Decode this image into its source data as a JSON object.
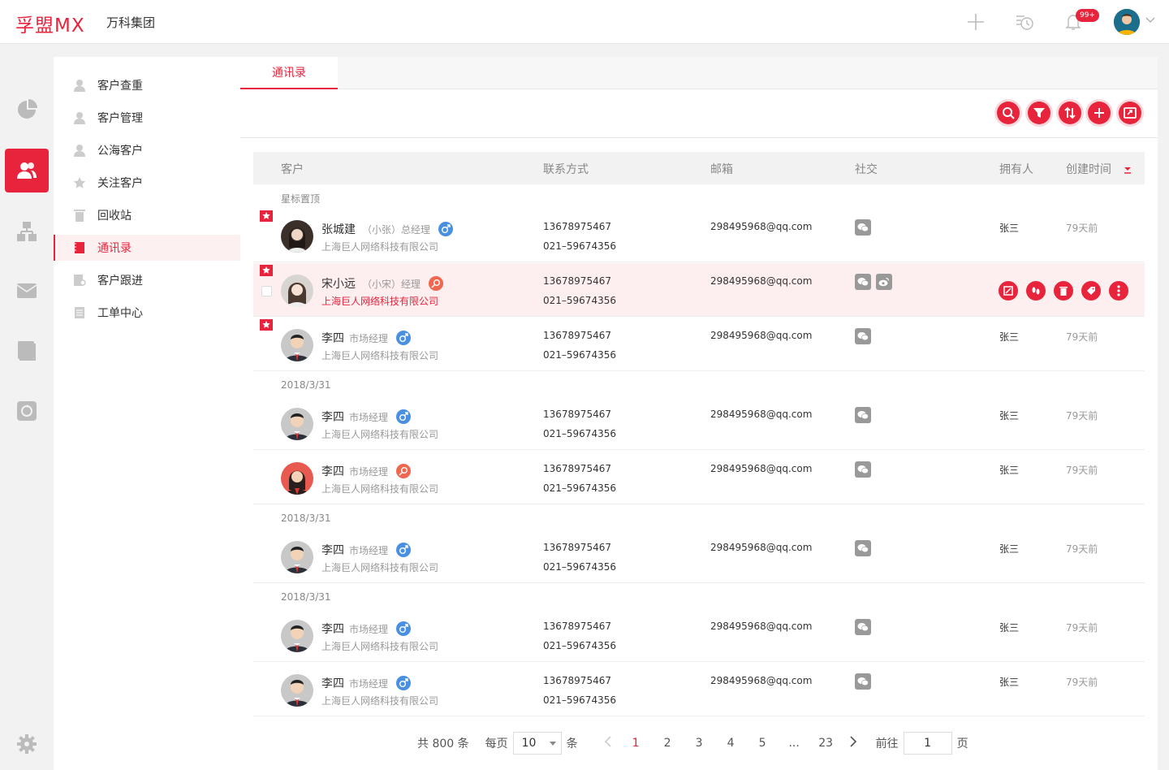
{
  "topbar": {
    "logo": "孚盟MX",
    "company": "万科集团",
    "notification_badge": "99+",
    "icons": [
      "plus-icon",
      "history-icon",
      "bell-icon",
      "avatar",
      "chevron-down-icon"
    ]
  },
  "rail": {
    "items": [
      "pie-chart-icon",
      "users-icon",
      "org-chart-icon",
      "mail-icon",
      "book-icon",
      "recycle-icon",
      "settings-icon"
    ],
    "active": "users-icon"
  },
  "subnav": {
    "items": [
      {
        "label": "客户查重",
        "icon": "user-search-icon"
      },
      {
        "label": "客户管理",
        "icon": "user-icon"
      },
      {
        "label": "公海客户",
        "icon": "user-public-icon"
      },
      {
        "label": "关注客户",
        "icon": "star-icon"
      },
      {
        "label": "回收站",
        "icon": "trash-icon"
      },
      {
        "label": "通讯录",
        "icon": "contacts-icon"
      },
      {
        "label": "客户跟进",
        "icon": "followup-icon"
      },
      {
        "label": "工单中心",
        "icon": "ticket-icon"
      }
    ],
    "active_index": 5
  },
  "main": {
    "tab": "通讯录",
    "toolbar": [
      "search-icon",
      "filter-icon",
      "sort-icon",
      "add-icon",
      "export-icon"
    ]
  },
  "table": {
    "headers": {
      "customer": "客户",
      "contact": "联系方式",
      "email": "邮箱",
      "social": "社交",
      "owner": "拥有人",
      "created": "创建时间"
    },
    "groups": [
      {
        "label": "星标置顶",
        "rows": [
          {
            "name": "张城建",
            "nickname": "（小张）",
            "title": "总经理",
            "gender": "male",
            "company": "上海巨人网络科技有限公司",
            "phone": "13678975467",
            "tel": "021–59674356",
            "email": "298495968@qq.com",
            "social": [
              "wechat"
            ],
            "owner": "张三",
            "created": "79天前",
            "starred": true,
            "avatar": "woman-dark"
          },
          {
            "name": "宋小远",
            "nickname": "（小宋）",
            "title": "经理",
            "gender": "female",
            "company": "上海巨人网络科技有限公司",
            "phone": "13678975467",
            "tel": "021–59674356",
            "email": "298495968@qq.com",
            "social": [
              "wechat",
              "weibo"
            ],
            "owner": "",
            "created": "",
            "starred": true,
            "highlight": true,
            "avatar": "woman-light",
            "actions": [
              "edit-icon",
              "footprint-icon",
              "delete-icon",
              "tag-icon",
              "more-icon"
            ]
          },
          {
            "name": "李四",
            "nickname": "",
            "title": "市场经理",
            "gender": "male",
            "company": "上海巨人网络科技有限公司",
            "phone": "13678975467",
            "tel": "021–59674356",
            "email": "298495968@qq.com",
            "social": [
              "wechat"
            ],
            "owner": "张三",
            "created": "79天前",
            "starred": true,
            "avatar": "man"
          }
        ]
      },
      {
        "label": "2018/3/31",
        "rows": [
          {
            "name": "李四",
            "nickname": "",
            "title": "市场经理",
            "gender": "male",
            "company": "上海巨人网络科技有限公司",
            "phone": "13678975467",
            "tel": "021–59674356",
            "email": "298495968@qq.com",
            "social": [
              "wechat"
            ],
            "owner": "张三",
            "created": "79天前",
            "avatar": "man"
          },
          {
            "name": "李四",
            "nickname": "",
            "title": "市场经理",
            "gender": "female",
            "company": "上海巨人网络科技有限公司",
            "phone": "13678975467",
            "tel": "021–59674356",
            "email": "298495968@qq.com",
            "social": [
              "wechat"
            ],
            "owner": "张三",
            "created": "79天前",
            "avatar": "woman-red"
          }
        ]
      },
      {
        "label": "2018/3/31",
        "rows": [
          {
            "name": "李四",
            "nickname": "",
            "title": "市场经理",
            "gender": "male",
            "company": "上海巨人网络科技有限公司",
            "phone": "13678975467",
            "tel": "021–59674356",
            "email": "298495968@qq.com",
            "social": [
              "wechat"
            ],
            "owner": "张三",
            "created": "79天前",
            "avatar": "man"
          }
        ]
      },
      {
        "label": "2018/3/31",
        "rows": [
          {
            "name": "李四",
            "nickname": "",
            "title": "市场经理",
            "gender": "male",
            "company": "上海巨人网络科技有限公司",
            "phone": "13678975467",
            "tel": "021–59674356",
            "email": "298495968@qq.com",
            "social": [
              "wechat"
            ],
            "owner": "张三",
            "created": "79天前",
            "avatar": "man"
          },
          {
            "name": "李四",
            "nickname": "",
            "title": "市场经理",
            "gender": "male",
            "company": "上海巨人网络科技有限公司",
            "phone": "13678975467",
            "tel": "021–59674356",
            "email": "298495968@qq.com",
            "social": [
              "wechat"
            ],
            "owner": "张三",
            "created": "79天前",
            "avatar": "man"
          }
        ]
      }
    ]
  },
  "pager": {
    "total": "共 800 条",
    "per_page_label": "每页",
    "per_page_value": "10",
    "per_page_unit": "条",
    "pages": [
      "1",
      "2",
      "3",
      "4",
      "5",
      "...",
      "23"
    ],
    "current": "1",
    "goto_label": "前往",
    "goto_value": "1",
    "goto_unit": "页"
  },
  "colors": {
    "accent": "#e8243c",
    "male": "#4a90e2",
    "female": "#f0674f"
  }
}
